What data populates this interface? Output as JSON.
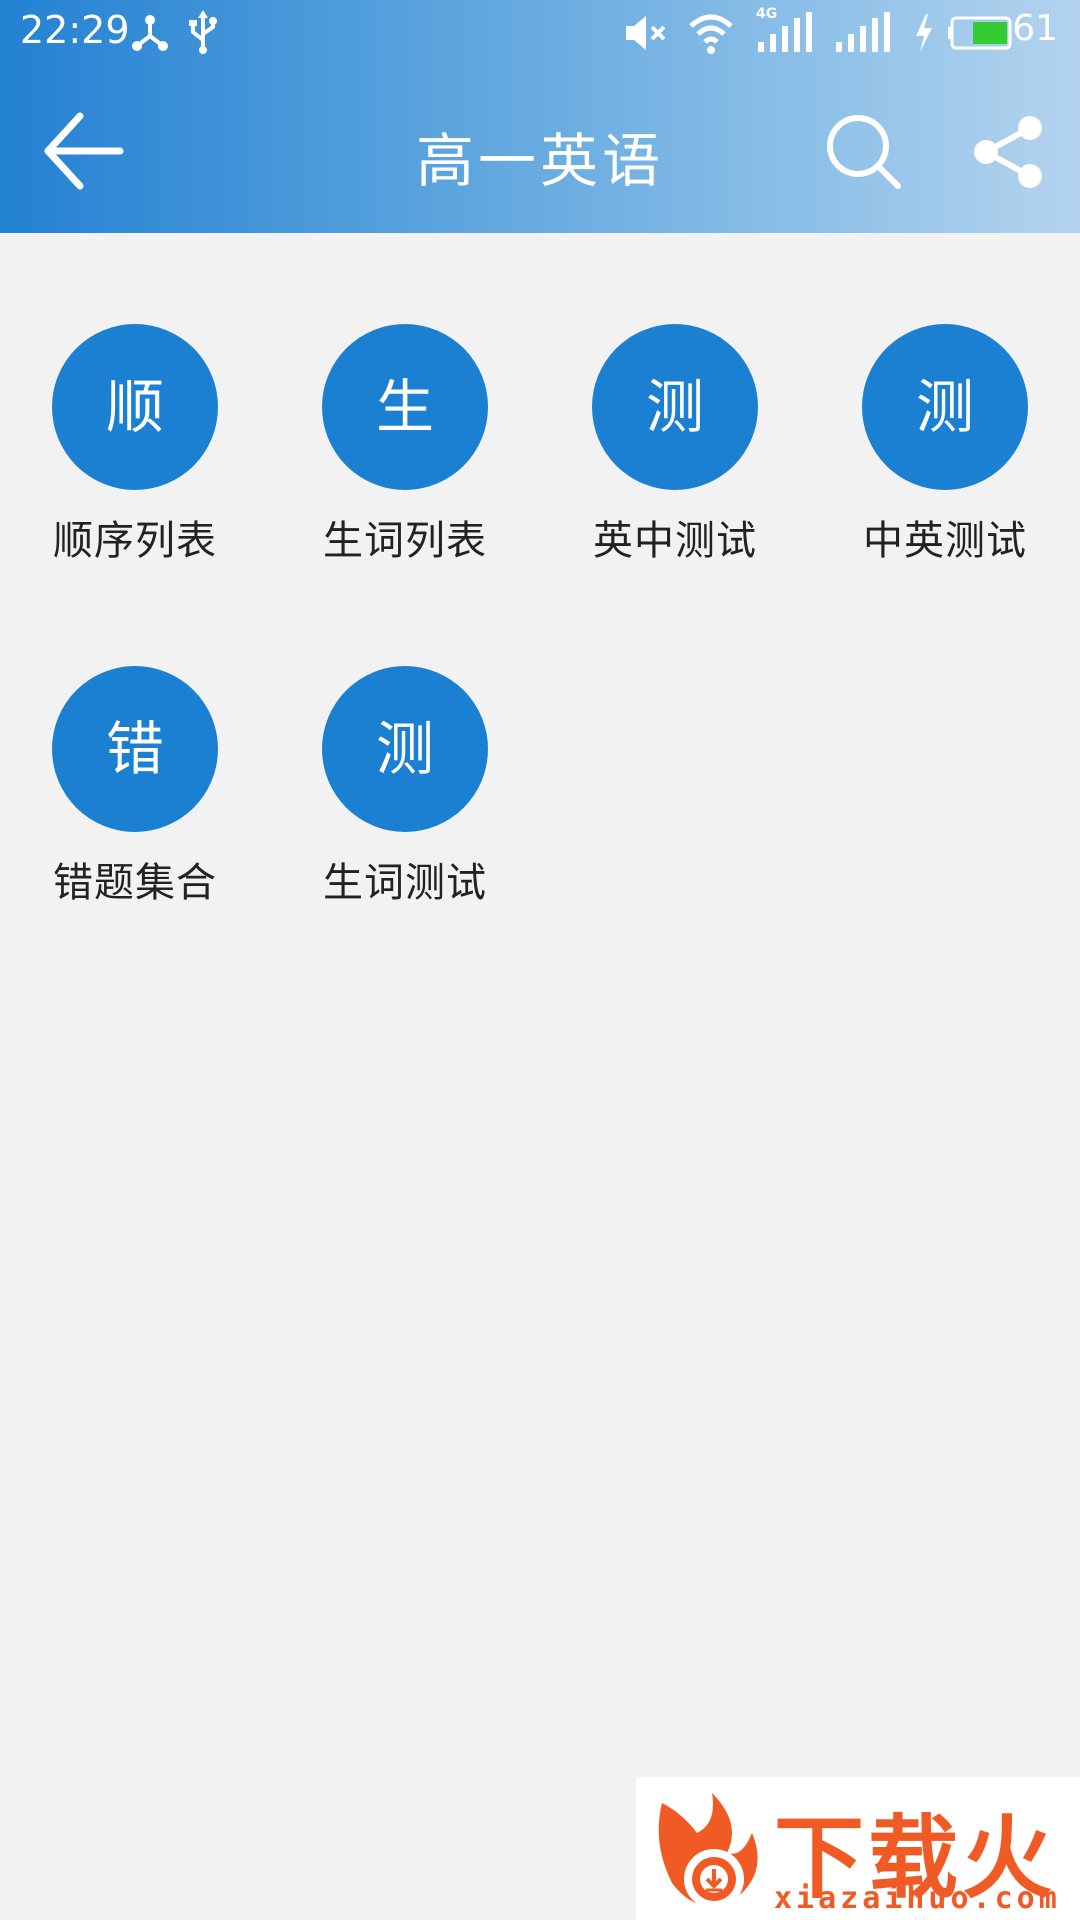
{
  "status_bar": {
    "time": "22:29",
    "battery_percent": "61",
    "network_type": "4G",
    "icons": [
      "usb-tether-icon",
      "usb-icon",
      "mute-icon",
      "wifi-icon",
      "signal-4g-icon",
      "signal-icon",
      "charging-icon",
      "battery-icon"
    ]
  },
  "app_bar": {
    "title": "高一英语",
    "back_icon": "arrow-left-icon",
    "search_icon": "search-icon",
    "share_icon": "share-icon"
  },
  "menu": {
    "items": [
      {
        "glyph": "顺",
        "label": "顺序列表"
      },
      {
        "glyph": "生",
        "label": "生词列表"
      },
      {
        "glyph": "测",
        "label": "英中测试"
      },
      {
        "glyph": "测",
        "label": "中英测试"
      },
      {
        "glyph": "错",
        "label": "错题集合"
      },
      {
        "glyph": "测",
        "label": "生词测试"
      }
    ]
  },
  "watermark": {
    "brand": "下载火",
    "url": "xiazaihuo.com"
  },
  "colors": {
    "accent": "#1c80d2",
    "header_start": "#2381d3",
    "header_end": "#b3d3ee",
    "background": "#f2f2f2",
    "watermark": "#f05a24",
    "battery_fill": "#33cc33"
  }
}
